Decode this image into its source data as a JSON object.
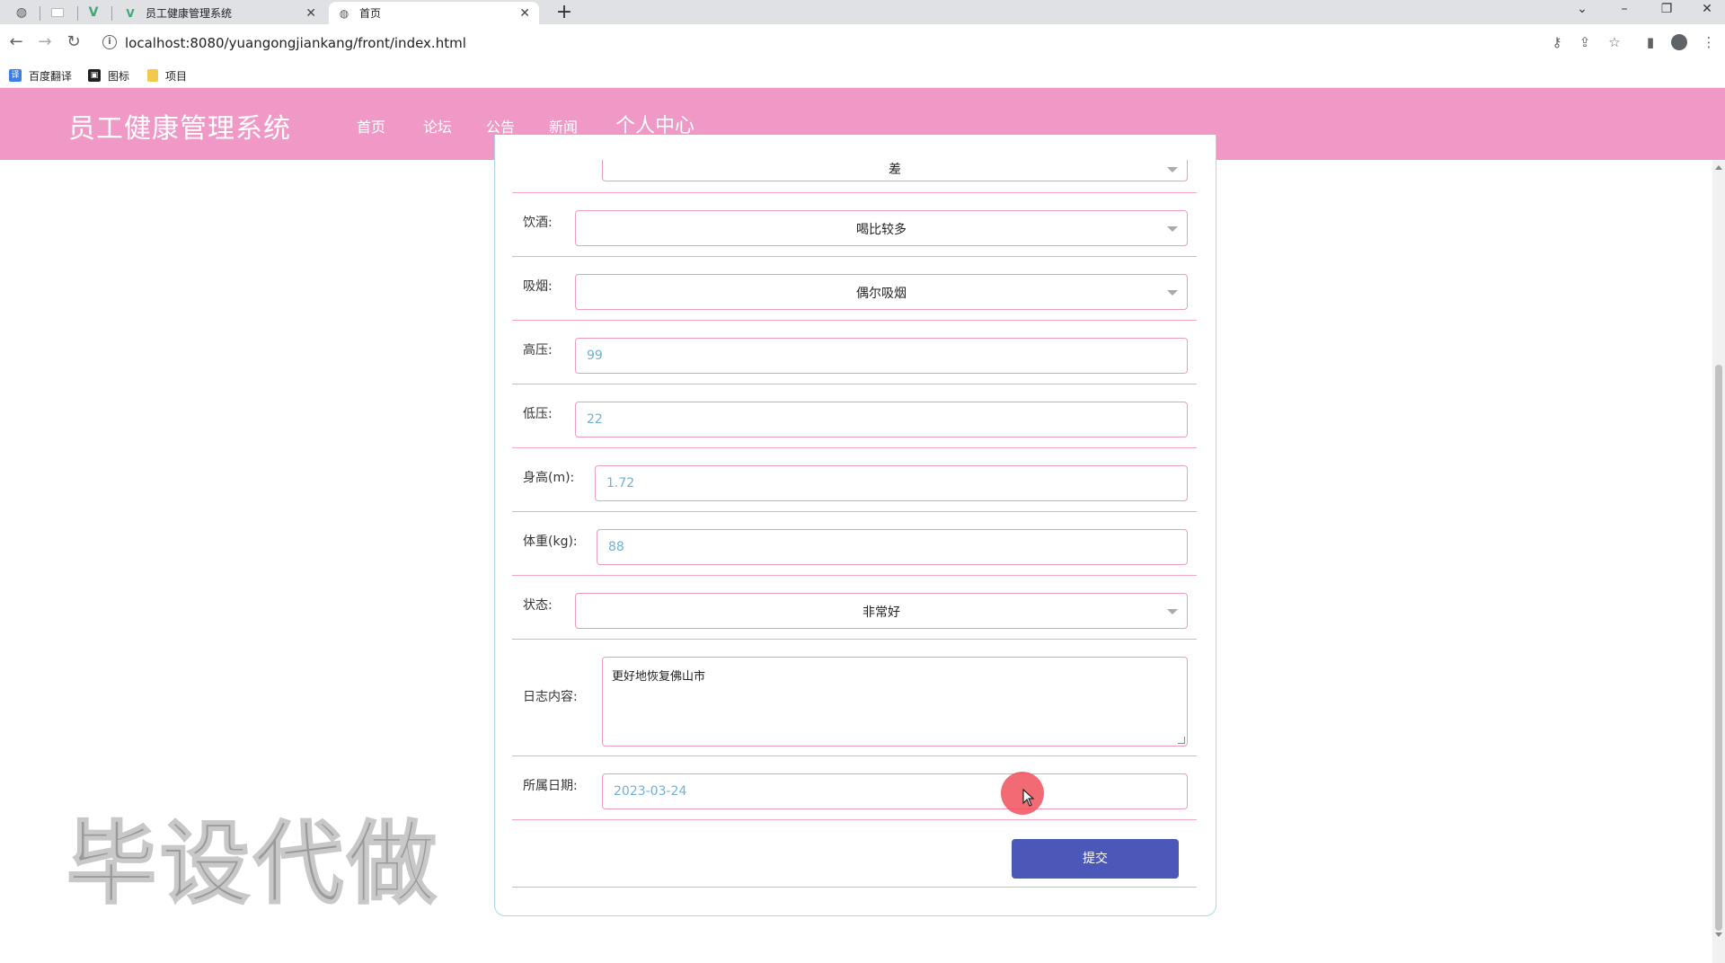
{
  "browser": {
    "tabs": [
      {
        "title": "员工健康管理系统",
        "active": false
      },
      {
        "title": "首页",
        "active": true
      }
    ],
    "url": "localhost:8080/yuangongjiankang/front/index.html",
    "bookmarks": [
      "百度翻译",
      "图标",
      "项目"
    ],
    "tab_close_glyph": "✕",
    "newtab_glyph": "+"
  },
  "site": {
    "title": "员工健康管理系统",
    "nav": [
      "首页",
      "论坛",
      "公告",
      "新闻",
      "个人中心"
    ],
    "active_nav": "个人中心"
  },
  "form": {
    "partial_top_value": "差",
    "drinking": {
      "label": "饮酒:",
      "value": "喝比较多"
    },
    "smoking": {
      "label": "吸烟:",
      "value": "偶尔吸烟"
    },
    "systolic": {
      "label": "高压:",
      "value": "99"
    },
    "diastolic": {
      "label": "低压:",
      "value": "22"
    },
    "height": {
      "label": "身高(m):",
      "value": "1.72"
    },
    "weight": {
      "label": "体重(kg):",
      "value": "88"
    },
    "status": {
      "label": "状态:",
      "value": "非常好"
    },
    "log": {
      "label": "日志内容:",
      "value": "更好地恢复佛山市"
    },
    "date": {
      "label": "所属日期:",
      "value": "2023-03-24"
    },
    "submit_label": "提交"
  },
  "watermark": "毕设代做",
  "colors": {
    "header_bg": "#f099c7",
    "field_border": "#ec9dbd",
    "input_text": "#6fb1d6",
    "submit_bg": "#4b58b8",
    "card_border": "#a7d8e8"
  }
}
